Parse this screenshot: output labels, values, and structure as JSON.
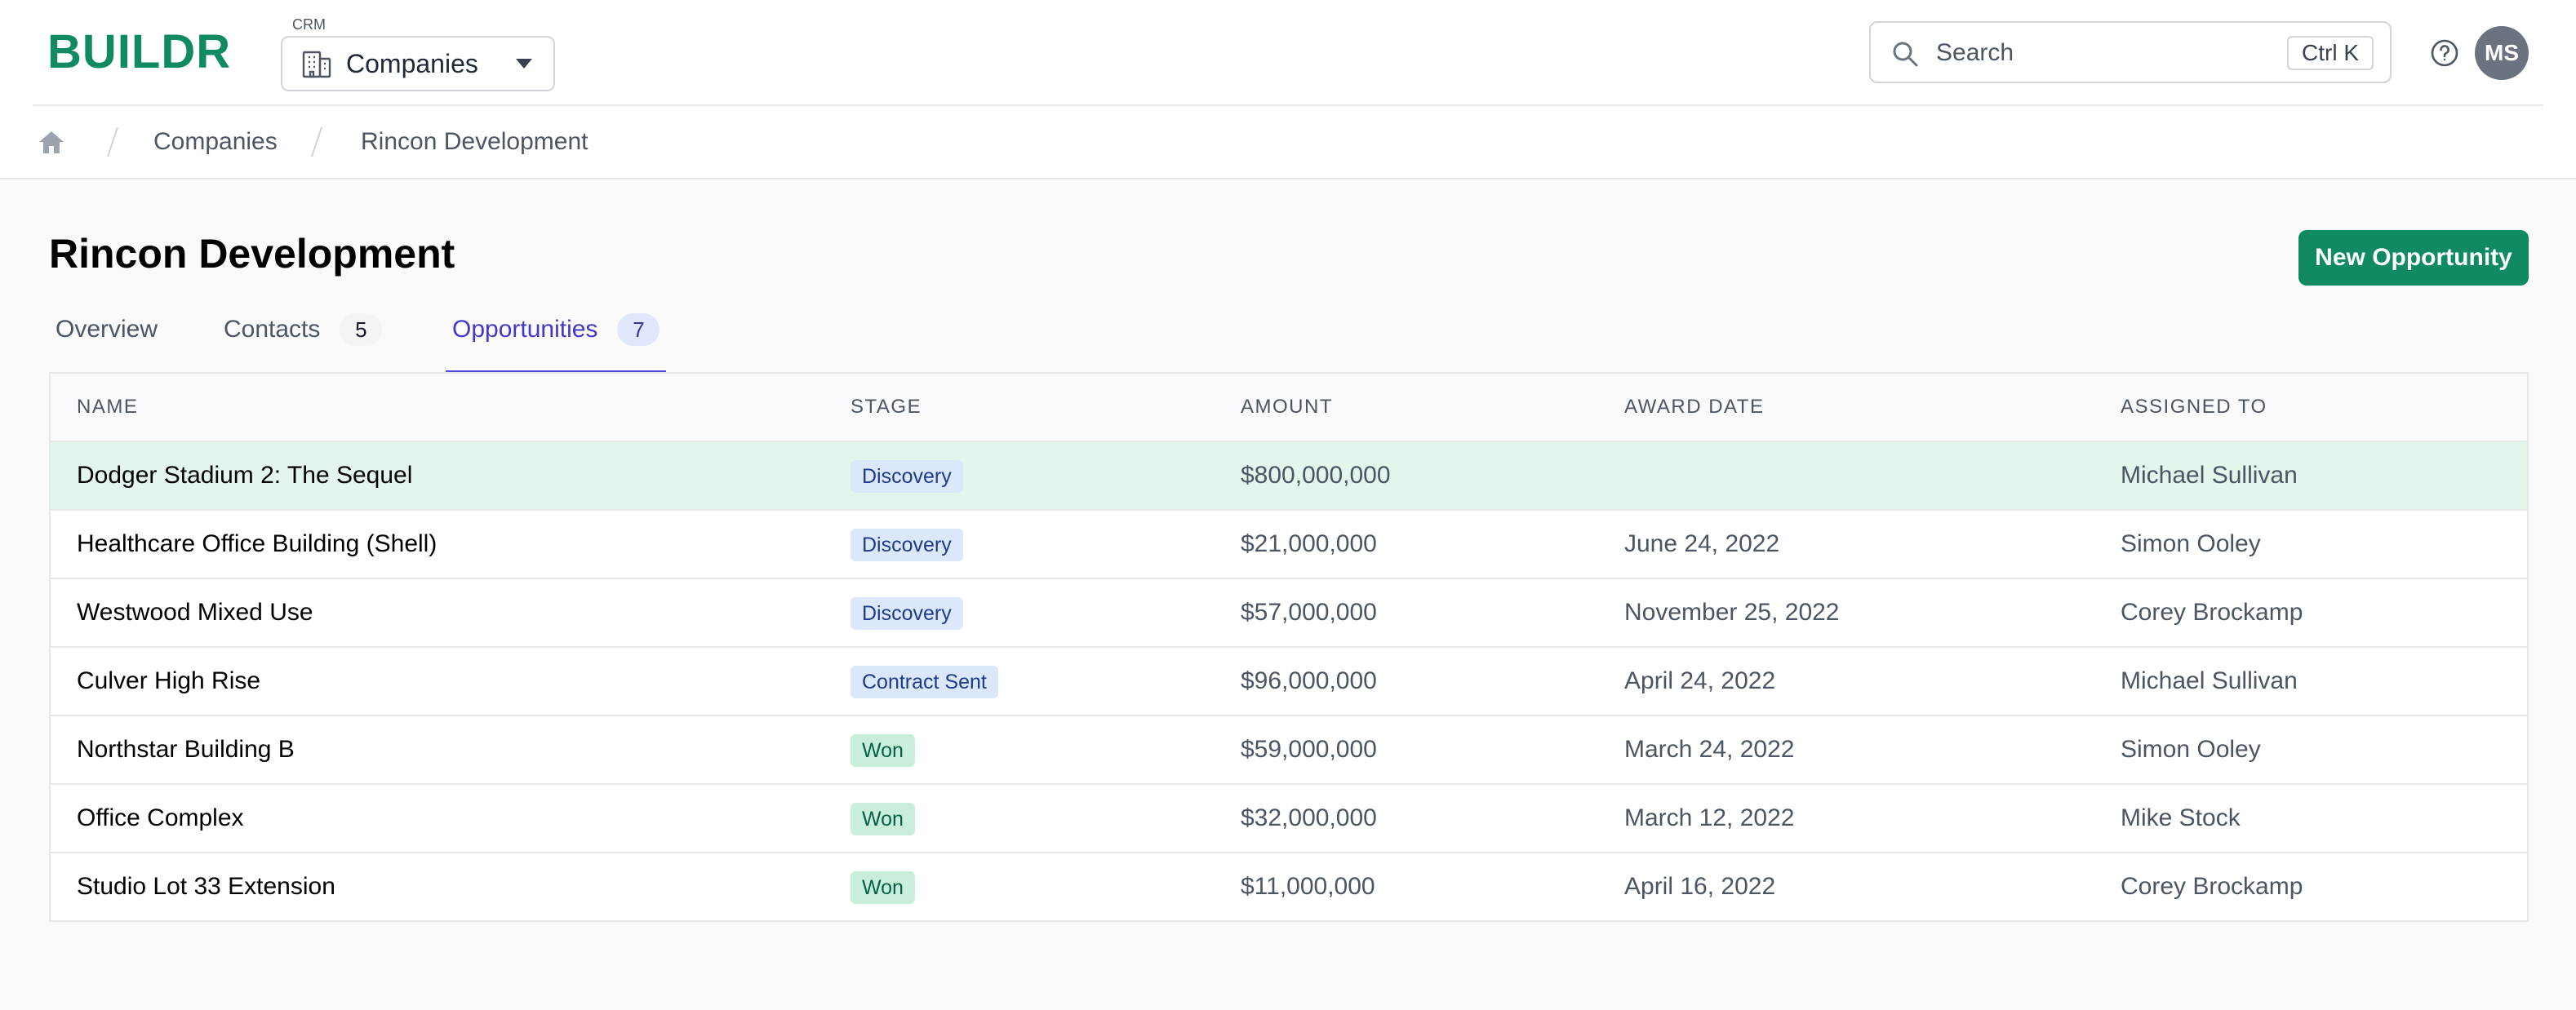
{
  "app": {
    "logo": "BUILDR",
    "module_label": "CRM",
    "module_value": "Companies"
  },
  "search": {
    "placeholder": "Search",
    "shortcut": "Ctrl K"
  },
  "user": {
    "initials": "MS"
  },
  "breadcrumb": {
    "items": [
      "Companies",
      "Rincon Development"
    ]
  },
  "page": {
    "title": "Rincon Development",
    "primary_action": "New Opportunity"
  },
  "tabs": [
    {
      "label": "Overview",
      "count": null,
      "active": false
    },
    {
      "label": "Contacts",
      "count": "5",
      "active": false
    },
    {
      "label": "Opportunities",
      "count": "7",
      "active": true
    }
  ],
  "table": {
    "columns": [
      "NAME",
      "STAGE",
      "AMOUNT",
      "AWARD DATE",
      "ASSIGNED TO"
    ],
    "rows": [
      {
        "name": "Dodger Stadium 2: The Sequel",
        "stage": "Discovery",
        "stage_color": "blue",
        "amount": "$800,000,000",
        "award_date": "",
        "assigned_to": "Michael Sullivan",
        "highlighted": true
      },
      {
        "name": "Healthcare Office Building (Shell)",
        "stage": "Discovery",
        "stage_color": "blue",
        "amount": "$21,000,000",
        "award_date": "June 24, 2022",
        "assigned_to": "Simon Ooley"
      },
      {
        "name": "Westwood Mixed Use",
        "stage": "Discovery",
        "stage_color": "blue",
        "amount": "$57,000,000",
        "award_date": "November 25, 2022",
        "assigned_to": "Corey Brockamp"
      },
      {
        "name": "Culver High Rise",
        "stage": "Contract Sent",
        "stage_color": "blue",
        "amount": "$96,000,000",
        "award_date": "April 24, 2022",
        "assigned_to": "Michael Sullivan"
      },
      {
        "name": "Northstar Building B",
        "stage": "Won",
        "stage_color": "green",
        "amount": "$59,000,000",
        "award_date": "March 24, 2022",
        "assigned_to": "Simon Ooley"
      },
      {
        "name": "Office Complex",
        "stage": "Won",
        "stage_color": "green",
        "amount": "$32,000,000",
        "award_date": "March 12, 2022",
        "assigned_to": "Mike Stock"
      },
      {
        "name": "Studio Lot 33 Extension",
        "stage": "Won",
        "stage_color": "green",
        "amount": "$11,000,000",
        "award_date": "April 16, 2022",
        "assigned_to": "Corey Brockamp"
      }
    ]
  },
  "colors": {
    "brand": "#0f8a63",
    "tab_active": "#4f46e5",
    "row_highlight": "#e4f5ec"
  }
}
